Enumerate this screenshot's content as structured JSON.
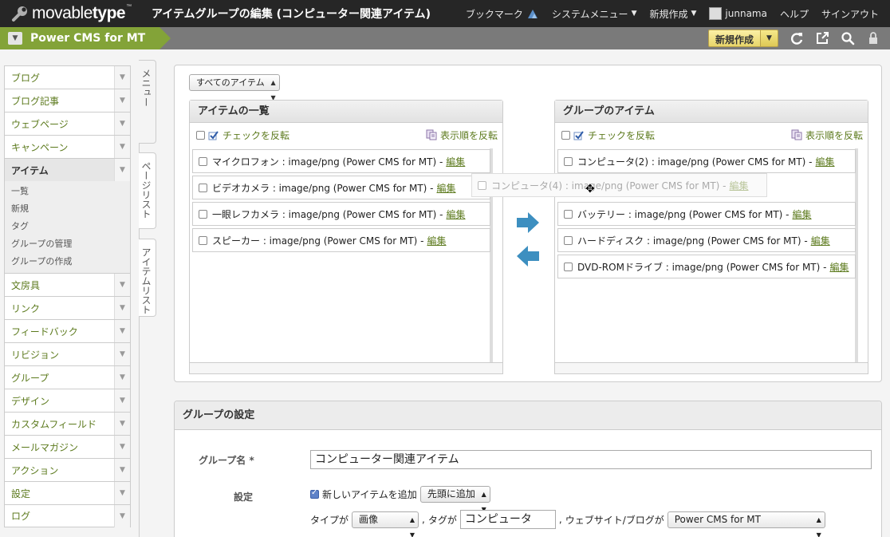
{
  "topbar": {
    "logo_text_a": "movable",
    "logo_text_b": "type",
    "logo_tm": "™",
    "page_title": "アイテムグループの編集 (コンピューター関連アイテム)",
    "bookmark": "ブックマーク",
    "system_menu": "システムメニュー",
    "new_create": "新規作成",
    "username": "junnama",
    "help": "ヘルプ",
    "signout": "サインアウト"
  },
  "blogbar": {
    "blog_name": "Power CMS for MT",
    "new_button": "新規作成"
  },
  "sidebar": {
    "items_top": [
      {
        "label": "ブログ"
      },
      {
        "label": "ブログ記事"
      },
      {
        "label": "ウェブページ"
      },
      {
        "label": "キャンペーン"
      }
    ],
    "active": {
      "label": "アイテム"
    },
    "submenu": [
      "一覧",
      "新規",
      "タグ",
      "グループの管理",
      "グループの作成"
    ],
    "items_bottom": [
      {
        "label": "文房具"
      },
      {
        "label": "リンク"
      },
      {
        "label": "フィードバック"
      },
      {
        "label": "リビジョン"
      },
      {
        "label": "グループ"
      },
      {
        "label": "デザイン"
      },
      {
        "label": "カスタムフィールド"
      },
      {
        "label": "メールマガジン"
      },
      {
        "label": "アクション"
      },
      {
        "label": "設定"
      },
      {
        "label": "ログ"
      }
    ]
  },
  "vtabs": {
    "menu": "メニュー",
    "pagelist": "ページリスト",
    "itemlist": "アイテムリスト"
  },
  "filter": {
    "value": "すべてのアイテム"
  },
  "left_list": {
    "title": "アイテムの一覧",
    "check_toggle": "チェックを反転",
    "sort_toggle": "表示順を反転",
    "rows": [
      {
        "text": "マイクロフォン : image/png (Power CMS for MT) -",
        "edit": "編集"
      },
      {
        "text": "ビデオカメラ : image/png (Power CMS for MT) -",
        "edit": "編集"
      },
      {
        "text": "一眼レフカメラ : image/png (Power CMS for MT) -",
        "edit": "編集"
      },
      {
        "text": "スピーカー : image/png (Power CMS for MT) -",
        "edit": "編集"
      }
    ]
  },
  "right_list": {
    "title": "グループのアイテム",
    "check_toggle": "チェックを反転",
    "sort_toggle": "表示順を反転",
    "rows": [
      {
        "text": "コンピュータ(2) : image/png (Power CMS for MT) -",
        "edit": "編集"
      },
      {
        "text": "バッテリー : image/png (Power CMS for MT) -",
        "edit": "編集"
      },
      {
        "text": "ハードディスク : image/png (Power CMS for MT) -",
        "edit": "編集"
      },
      {
        "text": "DVD-ROMドライブ : image/png (Power CMS for MT) -",
        "edit": "編集"
      }
    ]
  },
  "dragging": {
    "text": "コンピュータ(4) : image/png (Power CMS for MT) -",
    "edit": "編集"
  },
  "colors": {
    "accent_green": "#83a338",
    "link_green": "#5c7a1d",
    "arrow_blue": "#3d8fc0"
  },
  "settings": {
    "title": "グループの設定",
    "name_label": "グループ名 *",
    "name_value": "コンピューター関連アイテム",
    "settings_label": "設定",
    "add_new_label": "新しいアイテムを追加",
    "add_position": "先頭に追加",
    "type_label": "タイプが",
    "type_value": "画像",
    "comma1": ",",
    "tag_label": "タグが",
    "tag_value": "コンピュータ",
    "comma2": ",",
    "site_label": "ウェブサイト/ブログが",
    "site_value": "Power CMS for MT"
  }
}
